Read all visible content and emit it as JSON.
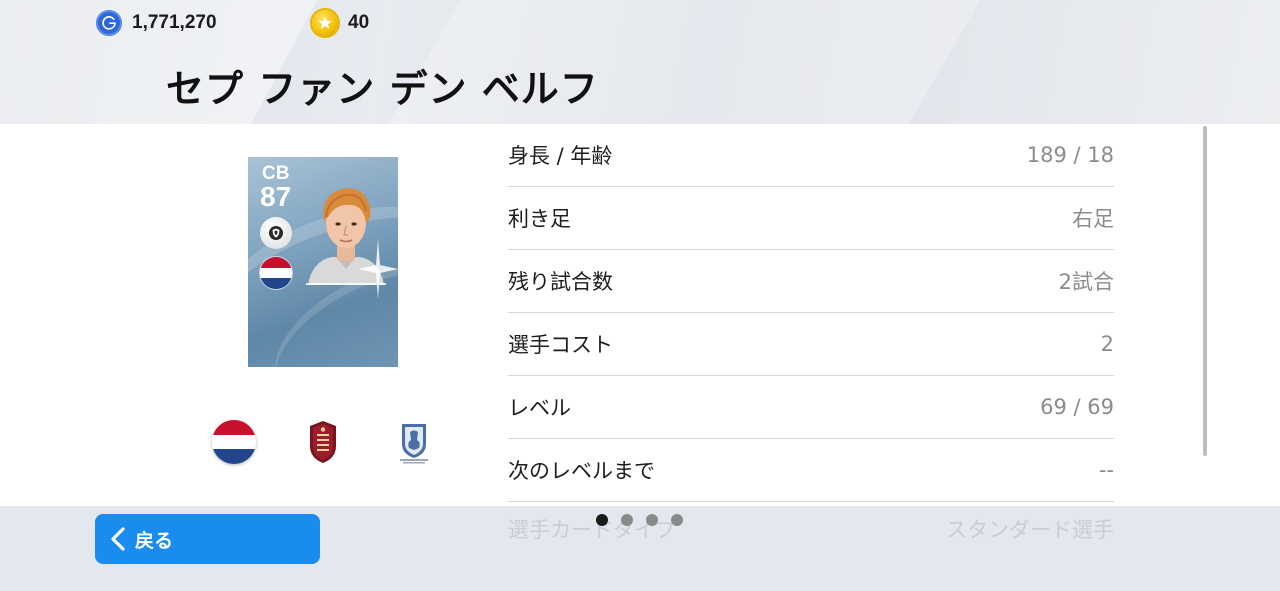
{
  "header": {
    "gp_amount": "1,771,270",
    "coin_amount": "40",
    "gp_icon": "gp-icon",
    "coin_icon": "star-coin-icon",
    "player_name": "セプ ファン デン ベルフ"
  },
  "card": {
    "position": "CB",
    "rating": "87",
    "playing_style_icon": "cb-style-badge-icon",
    "nationality_flag": "netherlands-flag",
    "card_color": "#7fa3bf"
  },
  "badges": {
    "nation": "netherlands-flag",
    "club": "club-crest-icon",
    "league": "english-league-badge-icon"
  },
  "stats": [
    {
      "label": "身長 / 年齢",
      "value": "189 / 18"
    },
    {
      "label": "利き足",
      "value": "右足"
    },
    {
      "label": "残り試合数",
      "value": "2試合"
    },
    {
      "label": "選手コスト",
      "value": "2"
    },
    {
      "label": "レベル",
      "value": "69 / 69"
    },
    {
      "label": "次のレベルまで",
      "value": "--"
    }
  ],
  "faded_stat": {
    "label": "選手カードタイプ",
    "value": "スタンダード選手"
  },
  "footer": {
    "back_label": "戻る",
    "page_count": 4,
    "active_page": 1
  },
  "colors": {
    "accent_blue": "#1a8cf0",
    "background": "#e3e7ee"
  }
}
